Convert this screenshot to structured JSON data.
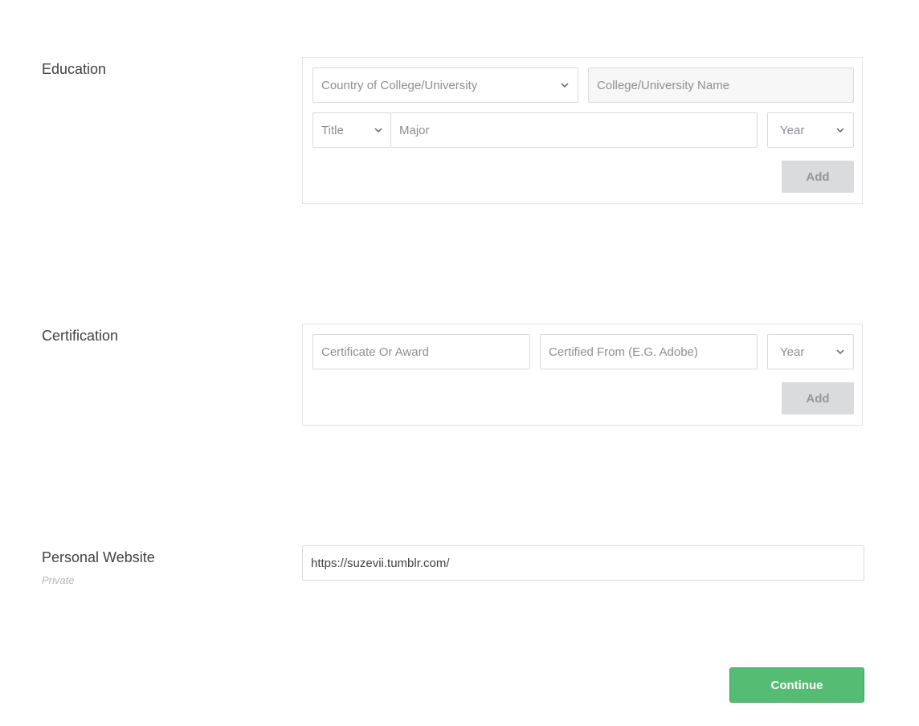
{
  "education": {
    "label": "Education",
    "country_placeholder": "Country of College/University",
    "college_placeholder": "College/University Name",
    "title_placeholder": "Title",
    "major_placeholder": "Major",
    "year_placeholder": "Year",
    "add_label": "Add"
  },
  "certification": {
    "label": "Certification",
    "certificate_placeholder": "Certificate Or Award",
    "certified_from_placeholder": "Certified From (E.G. Adobe)",
    "year_placeholder": "Year",
    "add_label": "Add"
  },
  "website": {
    "label": "Personal Website",
    "sublabel": "Private",
    "value": "https://suzevii.tumblr.com/"
  },
  "continue_label": "Continue",
  "icons": {
    "dropdown": "chevron-down-icon"
  },
  "colors": {
    "accent": "#55bc73",
    "text": "#404145",
    "placeholder": "#8e8f94",
    "disabled_button": "#dadbdd"
  }
}
